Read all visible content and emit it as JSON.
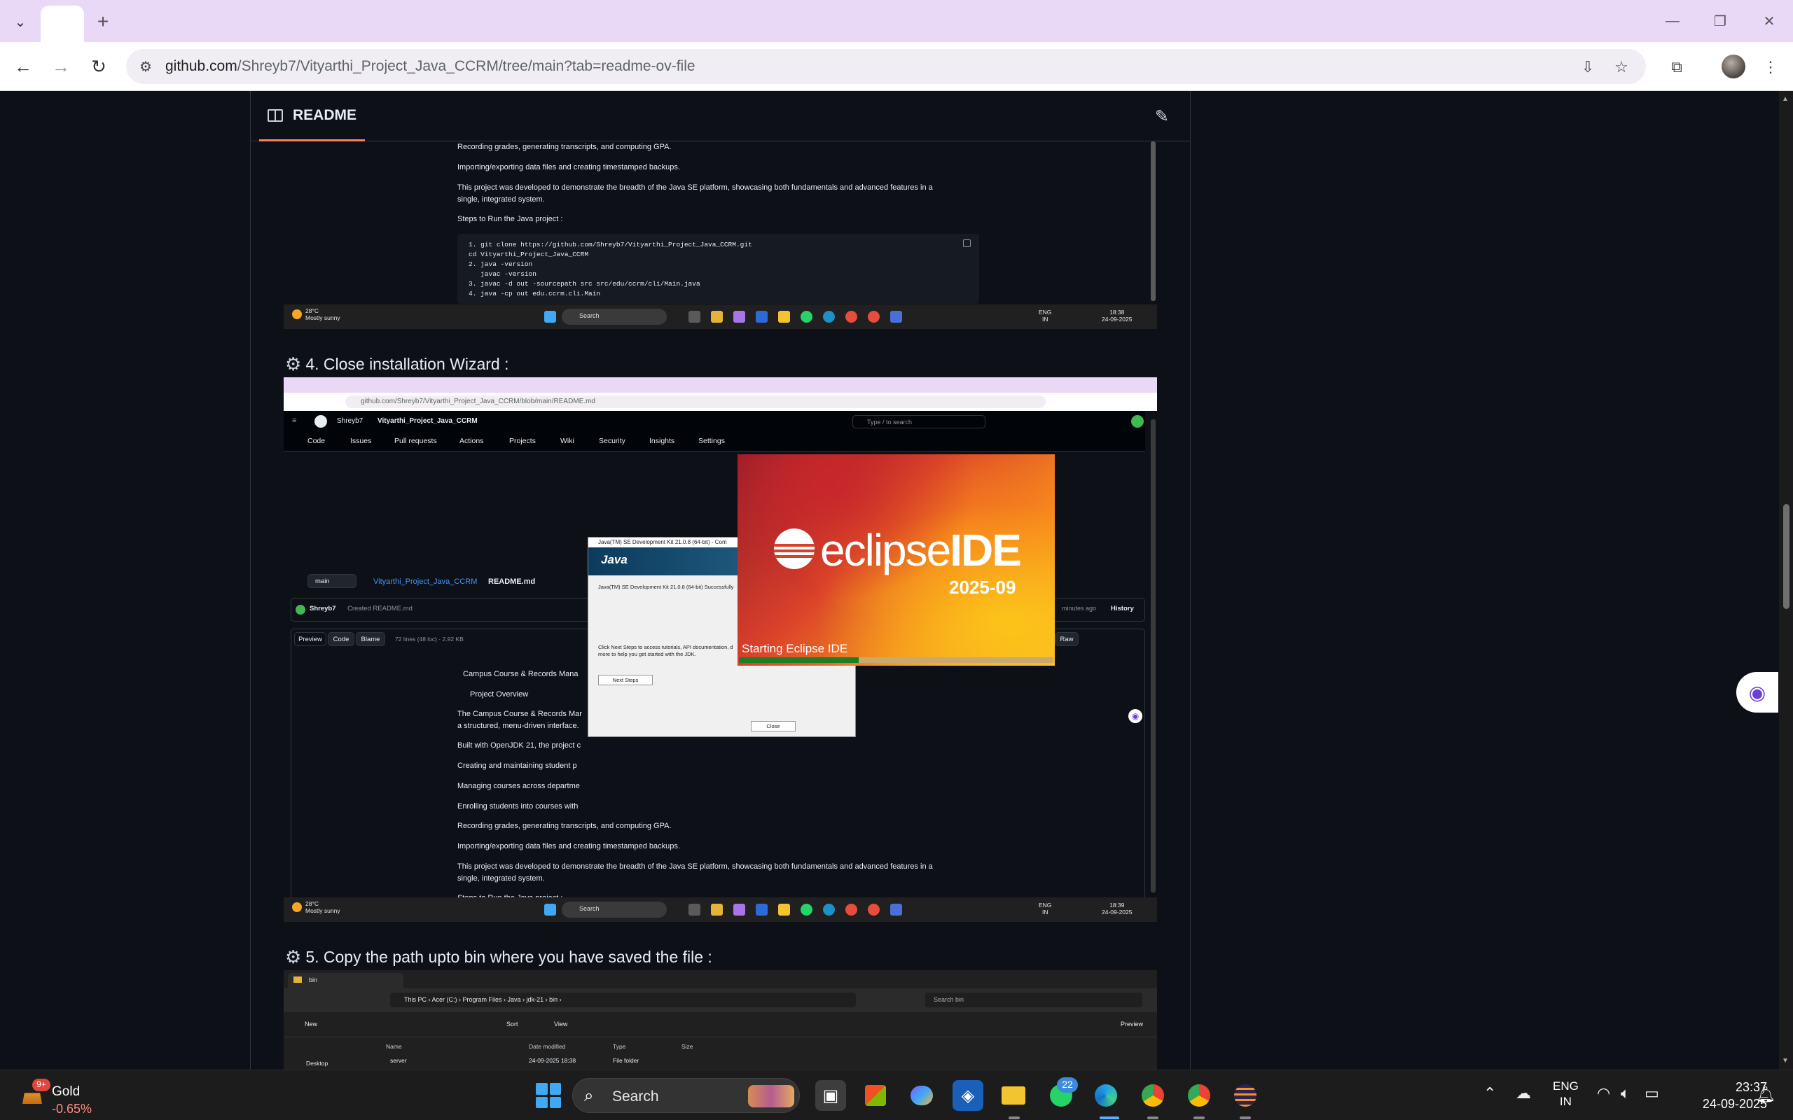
{
  "browser": {
    "url_host": "github.com",
    "url_path": "/Shreyb7/Vityarthi_Project_Java_CCRM/tree/main?tab=readme-ov-file",
    "icons": [
      "tab-list-icon",
      "new-tab-icon",
      "minimize-icon",
      "restore-icon",
      "close-icon",
      "back-icon",
      "forward-icon",
      "reload-icon",
      "site-info-icon",
      "install-icon",
      "bookmark-star-icon",
      "extensions-icon",
      "profile-avatar",
      "menu-icon"
    ]
  },
  "readme": {
    "tab_label": "README"
  },
  "shot1": {
    "lines": [
      "Recording grades, generating transcripts, and computing GPA.",
      "Importing/exporting data files and creating timestamped backups.",
      "This project was developed to demonstrate the breadth of the Java SE platform, showcasing both fundamentals and advanced features in a",
      "single, integrated system.",
      "Steps to Run the Java project :"
    ],
    "code": [
      "1. git clone https://github.com/Shreyb7/Vityarthi_Project_Java_CCRM.git",
      "cd Vityarthi_Project_Java_CCRM",
      "2. java -version",
      "   javac -version",
      "3. javac -d out -sourcepath src src/edu/ccrm/cli/Main.java",
      "4. java -cp out edu.ccrm.cli.Main"
    ],
    "taskbar": {
      "temp": "28°C",
      "weather": "Mostly sunny",
      "search": "Search",
      "lang1": "ENG",
      "lang2": "IN",
      "time": "18:38",
      "date": "24-09-2025"
    }
  },
  "step4": {
    "heading": "4. Close installation Wizard :"
  },
  "shot2": {
    "url": "github.com/Shreyb7/Vityarthi_Project_Java_CCRM/blob/main/README.md",
    "owner": "Shreyb7",
    "repo": "Vityarthi_Project_Java_CCRM",
    "search_placeholder": "Type / to search",
    "tabs": [
      "Code",
      "Issues",
      "Pull requests",
      "Actions",
      "Projects",
      "Wiki",
      "Security",
      "Insights",
      "Settings"
    ],
    "branch": "main",
    "breadcrumb_repo": "Vityarthi_Project_Java_CCRM",
    "breadcrumb_file": "README.md",
    "commit_user": "Shreyb7",
    "commit_msg": "Created README.md",
    "commit_time": "minutes ago",
    "history": "History",
    "view_buttons": [
      "Preview",
      "Code",
      "Blame"
    ],
    "file_meta": "72 lines (48 loc) · 2.92 KB",
    "raw": "Raw",
    "md_lines": [
      "Campus Course & Records Mana",
      "Project Overview",
      "The Campus Course & Records Mar",
      "a structured, menu-driven interface.",
      "Built with OpenJDK 21, the project c",
      "Creating and maintaining student p",
      "Managing courses across departme",
      "Enrolling students into courses with",
      "Recording grades, generating transcripts, and computing GPA.",
      "Importing/exporting data files and creating timestamped backups.",
      "This project was developed to demonstrate the breadth of the Java SE platform, showcasing both fundamentals and advanced features in a",
      "single, integrated system.",
      "Steps to Run the Java project :"
    ],
    "java_dialog": {
      "title": "Java(TM) SE Development Kit 21.0.8 (64-bit) - Com",
      "logo": "Java",
      "success": "Java(TM) SE Development Kit 21.0.8 (64-bit) Successfully",
      "info": "Click Next Steps to access tutorials, API documentation, d",
      "info2": "more to help you get started with the JDK.",
      "next_btn": "Next Steps",
      "close_btn": "Close"
    },
    "eclipse": {
      "word_light": "eclipse",
      "word_bold": "IDE",
      "version": "2025-09",
      "status": "Starting Eclipse IDE",
      "progress": 0.38
    },
    "taskbar": {
      "temp": "28°C",
      "weather": "Mostly sunny",
      "search": "Search",
      "lang1": "ENG",
      "lang2": "IN",
      "time": "18:39",
      "date": "24-09-2025"
    }
  },
  "step5": {
    "heading": "5. Copy the path upto bin where you have saved the file :"
  },
  "shot3": {
    "tab": "bin",
    "path": [
      "This PC",
      "Acer (C:)",
      "Program Files",
      "Java",
      "jdk-21",
      "bin"
    ],
    "search": "Search bin",
    "new": "New",
    "sort": "Sort",
    "view": "View",
    "preview": "Preview",
    "cols": [
      "Name",
      "Date modified",
      "Type",
      "Size"
    ],
    "side_item": "Desktop",
    "row": {
      "name": "server",
      "date": "24-09-2025 18:38",
      "type": "File folder"
    }
  },
  "taskbar": {
    "gold_badge": "9+",
    "gold_name": "Gold",
    "gold_change": "-0.65%",
    "search_label": "Search",
    "whatsapp_badge": "22",
    "lang1": "ENG",
    "lang2": "IN",
    "time": "23:37",
    "date": "24-09-2025"
  }
}
